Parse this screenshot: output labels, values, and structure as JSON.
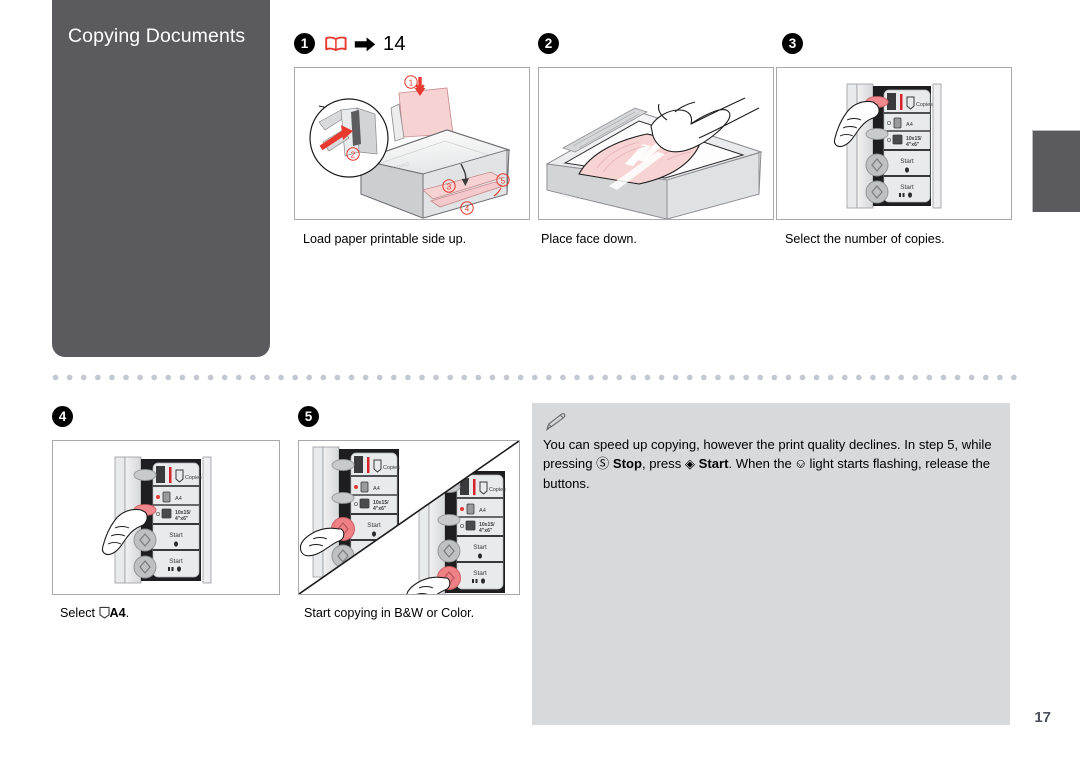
{
  "document": {
    "section_title": "Copying Documents",
    "page_number": "17"
  },
  "reference": {
    "step": "1",
    "book_icon": "open-book-icon",
    "arrow_icon": "right-arrow-icon",
    "page_ref": "14"
  },
  "steps": [
    {
      "number": "1",
      "badge": "1",
      "caption": "Load paper printable side up.",
      "callouts": [
        "1",
        "2",
        "3",
        "4",
        "5"
      ],
      "illustration": "printer-load-paper"
    },
    {
      "number": "2",
      "badge": "2",
      "caption": "Place face down.",
      "illustration": "scanner-place-document"
    },
    {
      "number": "3",
      "badge": "3",
      "caption": "Select the number of copies.",
      "illustration": "control-panel-copies"
    },
    {
      "number": "4",
      "badge": "4",
      "caption_prefix": "Select ",
      "caption_icon": "paper-sheet-icon",
      "caption_value": "A4",
      "caption_suffix": ".",
      "illustration": "control-panel-paper-type"
    },
    {
      "number": "5",
      "badge": "5",
      "caption": "Start copying in B&W or Color.",
      "illustration": "control-panel-start-split"
    }
  ],
  "control_panel": {
    "copies_label": "Copies",
    "copies_value": "1",
    "paper_a4_label": "A4",
    "paper_photo_label_line1": "10x15/",
    "paper_photo_label_line2": "4\"x6\"",
    "start_bw_label": "Start",
    "start_color_label": "Start"
  },
  "note": {
    "icon": "pencil-note-icon",
    "text_part1": "You can speed up copying, however the print quality declines. In step 5, while pressing ",
    "stop_icon": "stop-button-icon",
    "stop_label": "Stop",
    "text_part2": ", press ",
    "start_icon": "start-diamond-icon",
    "start_label": "Start",
    "text_part3": ". When the ",
    "power_icon": "power-icon",
    "text_part4": " light starts flashing, release the buttons."
  },
  "colors": {
    "sidebar": "#5b5b5d",
    "accent_red": "#e8392f",
    "note_background": "#d8d9db",
    "page_number": "#4b4f5a",
    "panel_border": "#a9a9ad"
  }
}
